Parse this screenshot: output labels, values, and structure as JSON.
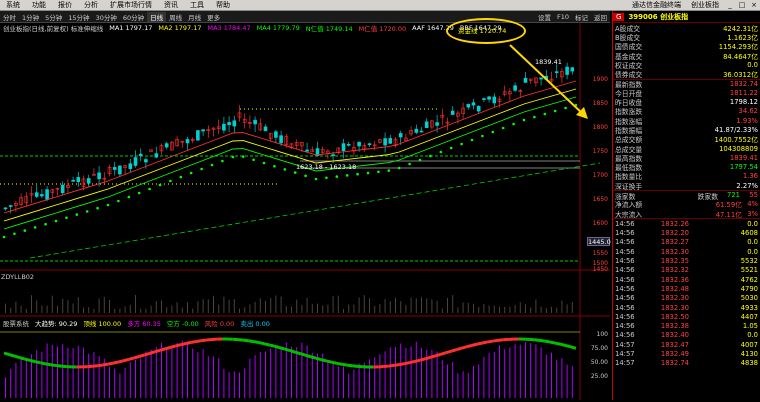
{
  "menubar": {
    "items": [
      "系统",
      "功能",
      "报价",
      "分析",
      "扩展市场行情",
      "资讯",
      "工具",
      "帮助"
    ],
    "middle": [
      "通达信金融终端",
      "创业板指"
    ],
    "window": [
      "_",
      "□",
      "×"
    ]
  },
  "tabs": [
    "分时",
    "1分钟",
    "5分钟",
    "15分钟",
    "30分钟",
    "60分钟",
    "日线",
    "周线",
    "月线",
    "更多"
  ],
  "active_tab": "日线",
  "toolbar_right": [
    "设置",
    "F10",
    "标记",
    "返回"
  ],
  "indicators": {
    "title": "创业板指(日线,前复权) 标准伸缩线",
    "items": [
      {
        "label": "MA1 1797.17",
        "color": "#ffffff"
      },
      {
        "label": "MA2 1797.17",
        "color": "#ffff00"
      },
      {
        "label": "MA3 1784.47",
        "color": "#ff00ff"
      },
      {
        "label": "MA4 1779.79",
        "color": "#00ff00"
      },
      {
        "label": "N仁值 1749.14",
        "color": "#00ff00"
      },
      {
        "label": "M仁值 1720.00",
        "color": "#ff4040"
      },
      {
        "label": "AAF 1647.29",
        "color": "#ffffff"
      },
      {
        "label": "BBF 1647.29",
        "color": "#ffffff"
      }
    ]
  },
  "callout": {
    "text": "资金线 1720.74"
  },
  "price_axis": [
    "1900",
    "1850",
    "1800",
    "1750",
    "1700",
    "1650",
    "1600",
    "1550",
    "1500",
    "1450"
  ],
  "cur_price": "1445.0",
  "annotations": {
    "peak": "1839.41",
    "low": "1623.18 - 1623.18",
    "sub1": "ZDYLLB02"
  },
  "sub2": {
    "label": "股票系统",
    "items": [
      {
        "label": "大趋势: 90.29",
        "color": "#ffffff"
      },
      {
        "label": "顶线 100.00",
        "color": "#ffff00"
      },
      {
        "label": "多方 60.35",
        "color": "#ff00ff"
      },
      {
        "label": "空方 -0.00",
        "color": "#00ff00"
      },
      {
        "label": "风险 0.00",
        "color": "#ff4040"
      },
      {
        "label": "卖出 0.00",
        "color": "#00ccff"
      }
    ],
    "axis": [
      "100",
      "75.00",
      "50.00",
      "25.00"
    ]
  },
  "panel": {
    "tag": "G",
    "code": "399006 创业板指",
    "rows": [
      {
        "l": "A股成交",
        "v": "4242.31亿",
        "c": "#ffff00"
      },
      {
        "l": "B股成交",
        "v": "1.1623亿",
        "c": "#ffff00"
      },
      {
        "l": "国债成交",
        "v": "1154.293亿",
        "c": "#ffff00"
      },
      {
        "l": "基金成交",
        "v": "84.4647亿",
        "c": "#ffff00"
      },
      {
        "l": "权证成交",
        "v": "0.0",
        "c": "#ffff00"
      },
      {
        "l": "债券成交",
        "v": "36.0312亿",
        "c": "#ffff00"
      },
      {
        "l": "最新指数",
        "v": "1832.74",
        "c": "#ff4040"
      },
      {
        "l": "今日开盘",
        "v": "1811.22",
        "c": "#ff4040"
      },
      {
        "l": "昨日收盘",
        "v": "1798.12",
        "c": "#ffffff"
      },
      {
        "l": "指数涨跌",
        "v": "34.62",
        "c": "#ff4040"
      },
      {
        "l": "指数涨幅",
        "v": "1.93%",
        "c": "#ff4040"
      },
      {
        "l": "指数振幅",
        "v": "41.87/2.33%",
        "c": "#ffffff"
      },
      {
        "l": "总成交额",
        "v": "1400.7552亿",
        "c": "#ffff00"
      },
      {
        "l": "总成交量",
        "v": "104308809",
        "c": "#ffff00"
      },
      {
        "l": "最高指数",
        "v": "1839.41",
        "c": "#ff4040"
      },
      {
        "l": "最低指数",
        "v": "1797.54",
        "c": "#00ff00"
      },
      {
        "l": "指数量比",
        "v": "1.36",
        "c": "#ff4040"
      },
      {
        "l": "深证换手",
        "v": "2.27%",
        "c": "#ffffff"
      }
    ],
    "updown": {
      "up_label": "涨家数",
      "up": "",
      "down_label": "跌家数",
      "down": "721",
      "flat": "55"
    },
    "flows": [
      {
        "l": "净流入额",
        "v": "61.59亿",
        "p": "4%"
      },
      {
        "l": "大宗流入",
        "v": "47.11亿",
        "p": "3%"
      }
    ],
    "ticks": [
      {
        "t": "14:56",
        "p": "1832.26",
        "v": "0.0"
      },
      {
        "t": "14:56",
        "p": "1832.20",
        "v": "4608"
      },
      {
        "t": "14:56",
        "p": "1832.27",
        "v": "0.0"
      },
      {
        "t": "14:56",
        "p": "1832.30",
        "v": "0.0"
      },
      {
        "t": "14:56",
        "p": "1832.35",
        "v": "5532"
      },
      {
        "t": "14:56",
        "p": "1832.32",
        "v": "5521"
      },
      {
        "t": "14:56",
        "p": "1832.36",
        "v": "4762"
      },
      {
        "t": "14:56",
        "p": "1832.48",
        "v": "4790"
      },
      {
        "t": "14:56",
        "p": "1832.30",
        "v": "5030"
      },
      {
        "t": "14:56",
        "p": "1832.30",
        "v": "4933"
      },
      {
        "t": "14:56",
        "p": "1832.50",
        "v": "4407"
      },
      {
        "t": "14:56",
        "p": "1832.38",
        "v": "1.05"
      },
      {
        "t": "14:56",
        "p": "1832.40",
        "v": "0.0"
      },
      {
        "t": "14:57",
        "p": "1832.47",
        "v": "4007"
      },
      {
        "t": "14:57",
        "p": "1832.49",
        "v": "4130"
      },
      {
        "t": "14:57",
        "p": "1832.74",
        "v": "4838"
      }
    ]
  }
}
